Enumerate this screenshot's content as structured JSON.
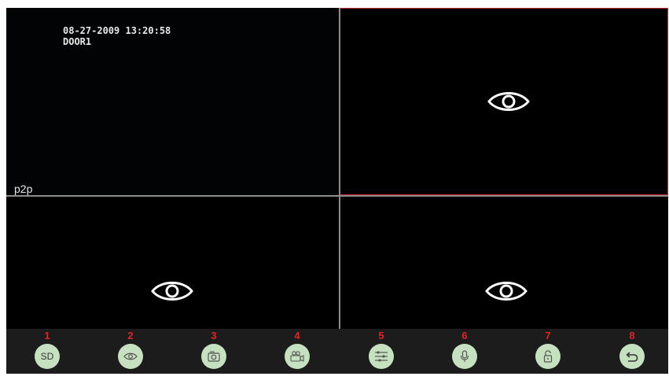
{
  "feeds": [
    {
      "timestamp": "08-27-2009 13:20:58",
      "camera": "DOOR1",
      "label": "p2p"
    },
    {
      "icon": "eye-icon"
    },
    {
      "icon": "eye-icon"
    },
    {
      "icon": "eye-icon"
    }
  ],
  "toolbar": {
    "buttons": [
      {
        "number": "1",
        "label": "SD",
        "icon": "sd-card"
      },
      {
        "number": "2",
        "icon": "eye-icon"
      },
      {
        "number": "3",
        "icon": "camera-icon"
      },
      {
        "number": "4",
        "icon": "video-camera-icon"
      },
      {
        "number": "5",
        "icon": "sliders-icon"
      },
      {
        "number": "6",
        "icon": "microphone-icon"
      },
      {
        "number": "7",
        "icon": "unlock-icon"
      },
      {
        "number": "8",
        "icon": "back-icon"
      }
    ]
  },
  "colors": {
    "active_border": "#c0262b",
    "button_bg": "#c6e1c0",
    "number_red": "#e22424"
  }
}
